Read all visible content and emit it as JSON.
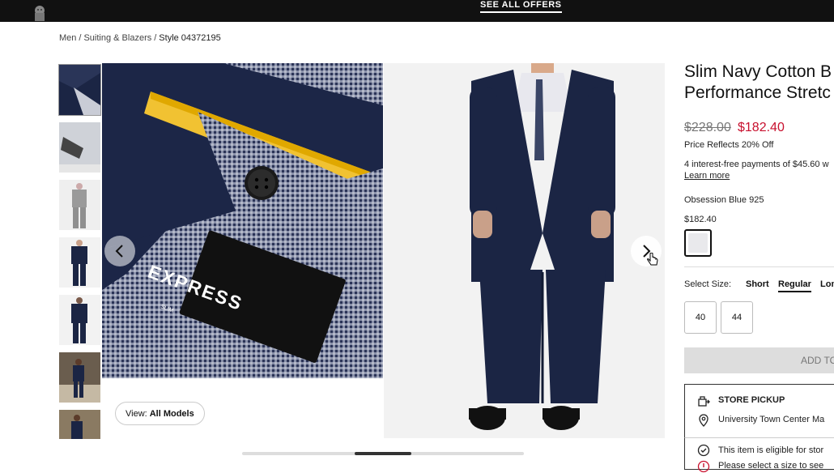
{
  "header": {
    "offers_label": "SEE ALL OFFERS"
  },
  "breadcrumb": {
    "items": [
      "Men",
      "Suiting & Blazers",
      "Style 04372195"
    ]
  },
  "gallery": {
    "view_prefix": "View:",
    "view_value": "All Models",
    "label_brand": "EXPRESS",
    "label_fit": "SLIM"
  },
  "product": {
    "title_line1": "Slim Navy Cotton B",
    "title_line2": "Performance Stretc",
    "price_original": "$228.00",
    "price_sale": "$182.40",
    "price_note": "Price Reflects 20% Off",
    "installments": "4 interest-free payments of $45.60 w",
    "learn_more": "Learn more",
    "color_name": "Obsession Blue 925",
    "color_price": "$182.40"
  },
  "size": {
    "label": "Select Size:",
    "fits": [
      "Short",
      "Regular",
      "Lon"
    ],
    "selected_fit": "Regular",
    "sizes": [
      "40",
      "44"
    ]
  },
  "cart": {
    "add_label": "ADD TO"
  },
  "pickup": {
    "title": "STORE PICKUP",
    "location": "University Town Center Ma",
    "eligible": "This item is eligible for stor",
    "warning": "Please select a size to see"
  },
  "colors": {
    "sale_red": "#c8102e",
    "topbar": "#111111",
    "navy": "#1b2544"
  }
}
